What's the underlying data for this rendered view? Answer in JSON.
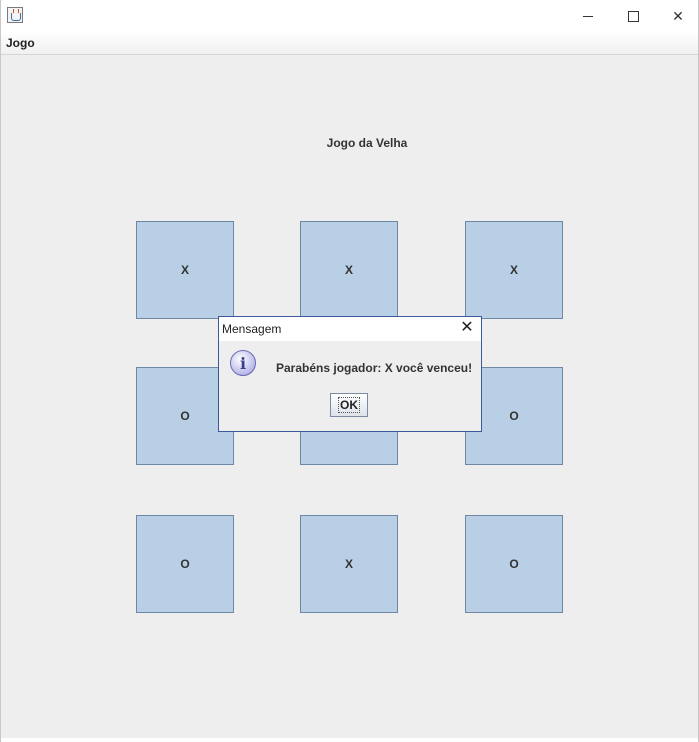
{
  "window": {
    "menu": [
      "Jogo"
    ],
    "heading": "Jogo da Velha"
  },
  "board": {
    "cells": [
      "X",
      "X",
      "X",
      "O",
      "",
      "O",
      "O",
      "X",
      "O"
    ]
  },
  "dialog": {
    "title": "Mensagem",
    "message": "Parabéns jogador: X você venceu!",
    "ok_label": "OK"
  },
  "colors": {
    "cell_fill": "#b8cfe5",
    "cell_border": "#6d87a4",
    "window_bg": "#eeeeee",
    "dialog_border": "#3b5a9a"
  },
  "icons": {
    "app": "java-cup-icon",
    "dialog": "info-icon"
  }
}
